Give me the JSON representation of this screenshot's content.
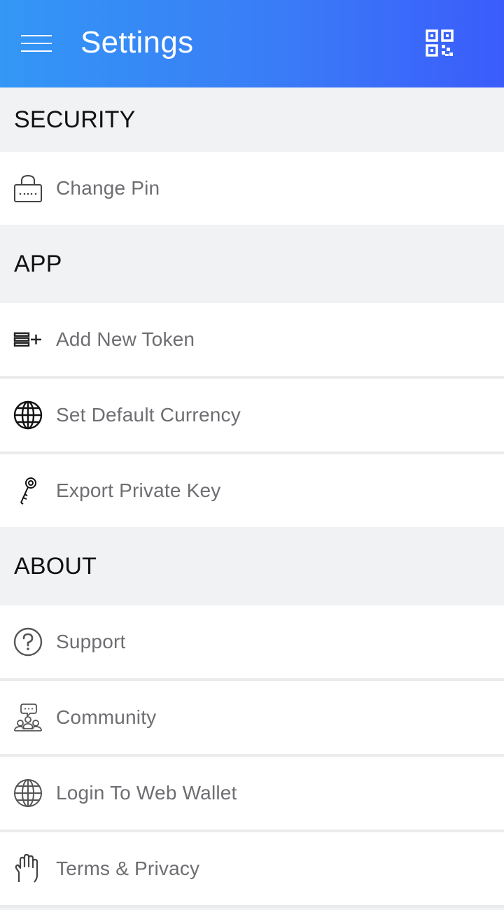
{
  "header": {
    "title": "Settings",
    "menu_icon": "hamburger-menu-icon",
    "qr_icon": "qr-code-icon",
    "gradient": [
      "#3397f5",
      "#3a5cfb"
    ]
  },
  "sections": {
    "security": {
      "title": "SECURITY",
      "items": [
        {
          "label": "Change Pin",
          "icon": "lock-icon"
        }
      ]
    },
    "app": {
      "title": "APP",
      "items": [
        {
          "label": "Add New Token",
          "icon": "add-list-icon"
        },
        {
          "label": "Set Default Currency",
          "icon": "globe-icon"
        },
        {
          "label": "Export Private Key",
          "icon": "key-icon"
        }
      ]
    },
    "about": {
      "title": "ABOUT",
      "items": [
        {
          "label": "Support",
          "icon": "question-circle-icon"
        },
        {
          "label": "Community",
          "icon": "community-icon"
        },
        {
          "label": "Login To Web Wallet",
          "icon": "globe-icon"
        },
        {
          "label": "Terms & Privacy",
          "icon": "hand-icon"
        }
      ]
    }
  }
}
